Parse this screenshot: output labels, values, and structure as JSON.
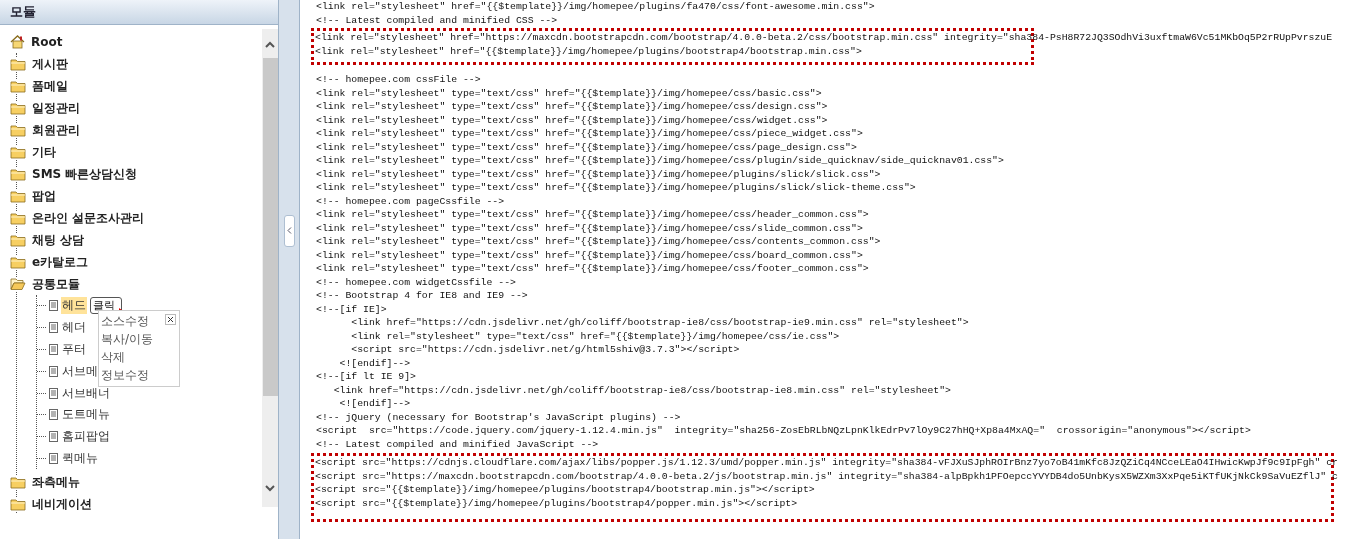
{
  "panel": {
    "title": "모듈"
  },
  "tree": {
    "label": "Root",
    "selected": false,
    "children": [
      {
        "kind": "folder",
        "label": "게시판",
        "expanded": false,
        "selected": false
      },
      {
        "kind": "folder",
        "label": "폼메일",
        "expanded": false,
        "selected": false
      },
      {
        "kind": "folder",
        "label": "일정관리",
        "expanded": false,
        "selected": false
      },
      {
        "kind": "folder",
        "label": "회원관리",
        "expanded": false,
        "selected": false
      },
      {
        "kind": "folder",
        "label": "기타",
        "expanded": false,
        "selected": false
      },
      {
        "kind": "folder",
        "label": "SMS 빠른상담신청",
        "expanded": false,
        "selected": false
      },
      {
        "kind": "folder",
        "label": "팝업",
        "expanded": false,
        "selected": false
      },
      {
        "kind": "folder",
        "label": "온라인 설문조사관리",
        "expanded": false,
        "selected": false
      },
      {
        "kind": "folder",
        "label": "채팅 상담",
        "expanded": false,
        "selected": false
      },
      {
        "kind": "folder",
        "label": "e카탈로그",
        "expanded": false,
        "selected": false
      },
      {
        "kind": "folder",
        "label": "공통모듈",
        "expanded": true,
        "selected": false,
        "children": [
          {
            "kind": "page",
            "label": "헤드",
            "selected": true,
            "badge": "클릭"
          },
          {
            "kind": "page",
            "label": "헤더",
            "selected": false
          },
          {
            "kind": "page",
            "label": "푸터",
            "selected": false
          },
          {
            "kind": "page",
            "label": "서브메",
            "selected": false
          },
          {
            "kind": "page",
            "label": "서브배너",
            "selected": false
          },
          {
            "kind": "page",
            "label": "도트메뉴",
            "selected": false
          },
          {
            "kind": "page",
            "label": "홈피팝업",
            "selected": false
          },
          {
            "kind": "page",
            "label": "퀵메뉴",
            "selected": false
          }
        ]
      },
      {
        "kind": "folder",
        "label": "좌측메뉴",
        "expanded": false,
        "selected": false
      },
      {
        "kind": "folder",
        "label": "네비게이션",
        "expanded": false,
        "selected": false
      }
    ]
  },
  "context_menu": {
    "items": [
      "소스수정",
      "복사/이동",
      "삭제",
      "정보수정"
    ]
  },
  "code": {
    "blocks": [
      {
        "kind": "plain",
        "lines": [
          "<link rel=\"stylesheet\" href=\"{{$template}}/img/homepee/plugins/fa470/css/font-awesome.min.css\">",
          "<!-- Latest compiled and minified CSS -->"
        ]
      },
      {
        "kind": "highlighted",
        "lines": [
          "<link rel=\"stylesheet\" href=\"https://maxcdn.bootstrapcdn.com/bootstrap/4.0.0-beta.2/css/bootstrap.min.css\" integrity=\"sha384-PsH8R72JQ3SOdhVi3uxftmaW6Vc51MKbOq5P2rRUpPvrszuE",
          "<link rel=\"stylesheet\" href=\"{{$template}}/img/homepee/plugins/bootstrap4/bootstrap.min.css\">"
        ]
      },
      {
        "kind": "plain",
        "lines": [
          "<!-- homepee.com cssFile -->",
          "<link rel=\"stylesheet\" type=\"text/css\" href=\"{{$template}}/img/homepee/css/basic.css\">",
          "<link rel=\"stylesheet\" type=\"text/css\" href=\"{{$template}}/img/homepee/css/design.css\">",
          "<link rel=\"stylesheet\" type=\"text/css\" href=\"{{$template}}/img/homepee/css/widget.css\">",
          "<link rel=\"stylesheet\" type=\"text/css\" href=\"{{$template}}/img/homepee/css/piece_widget.css\">",
          "<link rel=\"stylesheet\" type=\"text/css\" href=\"{{$template}}/img/homepee/css/page_design.css\">",
          "<link rel=\"stylesheet\" type=\"text/css\" href=\"{{$template}}/img/homepee/css/plugin/side_quicknav/side_quicknav01.css\">",
          "<link rel=\"stylesheet\" type=\"text/css\" href=\"{{$template}}/img/homepee/plugins/slick/slick.css\">",
          "<link rel=\"stylesheet\" type=\"text/css\" href=\"{{$template}}/img/homepee/plugins/slick/slick-theme.css\">",
          "<!-- homepee.com pageCssfile -->",
          "<link rel=\"stylesheet\" type=\"text/css\" href=\"{{$template}}/img/homepee/css/header_common.css\">",
          "<link rel=\"stylesheet\" type=\"text/css\" href=\"{{$template}}/img/homepee/css/slide_common.css\">",
          "<link rel=\"stylesheet\" type=\"text/css\" href=\"{{$template}}/img/homepee/css/contents_common.css\">",
          "<link rel=\"stylesheet\" type=\"text/css\" href=\"{{$template}}/img/homepee/css/board_common.css\">",
          "<link rel=\"stylesheet\" type=\"text/css\" href=\"{{$template}}/img/homepee/css/footer_common.css\">",
          "<!-- homepee.com widgetCssfile -->",
          "<!-- Bootstrap 4 for IE8 and IE9 -->",
          "<!--[if IE]>",
          "      <link href=\"https://cdn.jsdelivr.net/gh/coliff/bootstrap-ie8/css/bootstrap-ie9.min.css\" rel=\"stylesheet\">",
          "      <link rel=\"stylesheet\" type=\"text/css\" href=\"{{$template}}/img/homepee/css/ie.css\">",
          "      <script src=\"https://cdn.jsdelivr.net/g/html5shiv@3.7.3\"></script>",
          "    <![endif]-->",
          "<!--[if lt IE 9]>",
          "   <link href=\"https://cdn.jsdelivr.net/gh/coliff/bootstrap-ie8/css/bootstrap-ie8.min.css\" rel=\"stylesheet\">",
          "    <![endif]-->",
          "<!-- jQuery (necessary for Bootstrap's JavaScript plugins) -->",
          "<script  src=\"https://code.jquery.com/jquery-1.12.4.min.js\"  integrity=\"sha256-ZosEbRLbNQzLpnKlkEdrPv7lOy9C27hHQ+Xp8a4MxAQ=\"  crossorigin=\"anonymous\"></script>",
          "<!-- Latest compiled and minified JavaScript -->"
        ]
      },
      {
        "kind": "highlighted",
        "lines": [
          "<script src=\"https://cdnjs.cloudflare.com/ajax/libs/popper.js/1.12.3/umd/popper.min.js\" integrity=\"sha384-vFJXuSJphROIrBnz7yo7oB41mKfc8JzQZiCq4NCceLEaO4IHwicKwpJf9c9IpFgh\" cr",
          "<script src=\"https://maxcdn.bootstrapcdn.com/bootstrap/4.0.0-beta.2/js/bootstrap.min.js\" integrity=\"sha384-alpBpkh1PFOepccYVYDB4do5UnbKysX5WZXm3XxPqe5iKTfUKjNkCk9SaVuEZflJ\" c",
          "<script src=\"{{$template}}/img/homepee/plugins/bootstrap4/bootstrap.min.js\"></script>",
          "<script src=\"{{$template}}/img/homepee/plugins/bootstrap4/popper.min.js\"></script>"
        ]
      }
    ]
  }
}
